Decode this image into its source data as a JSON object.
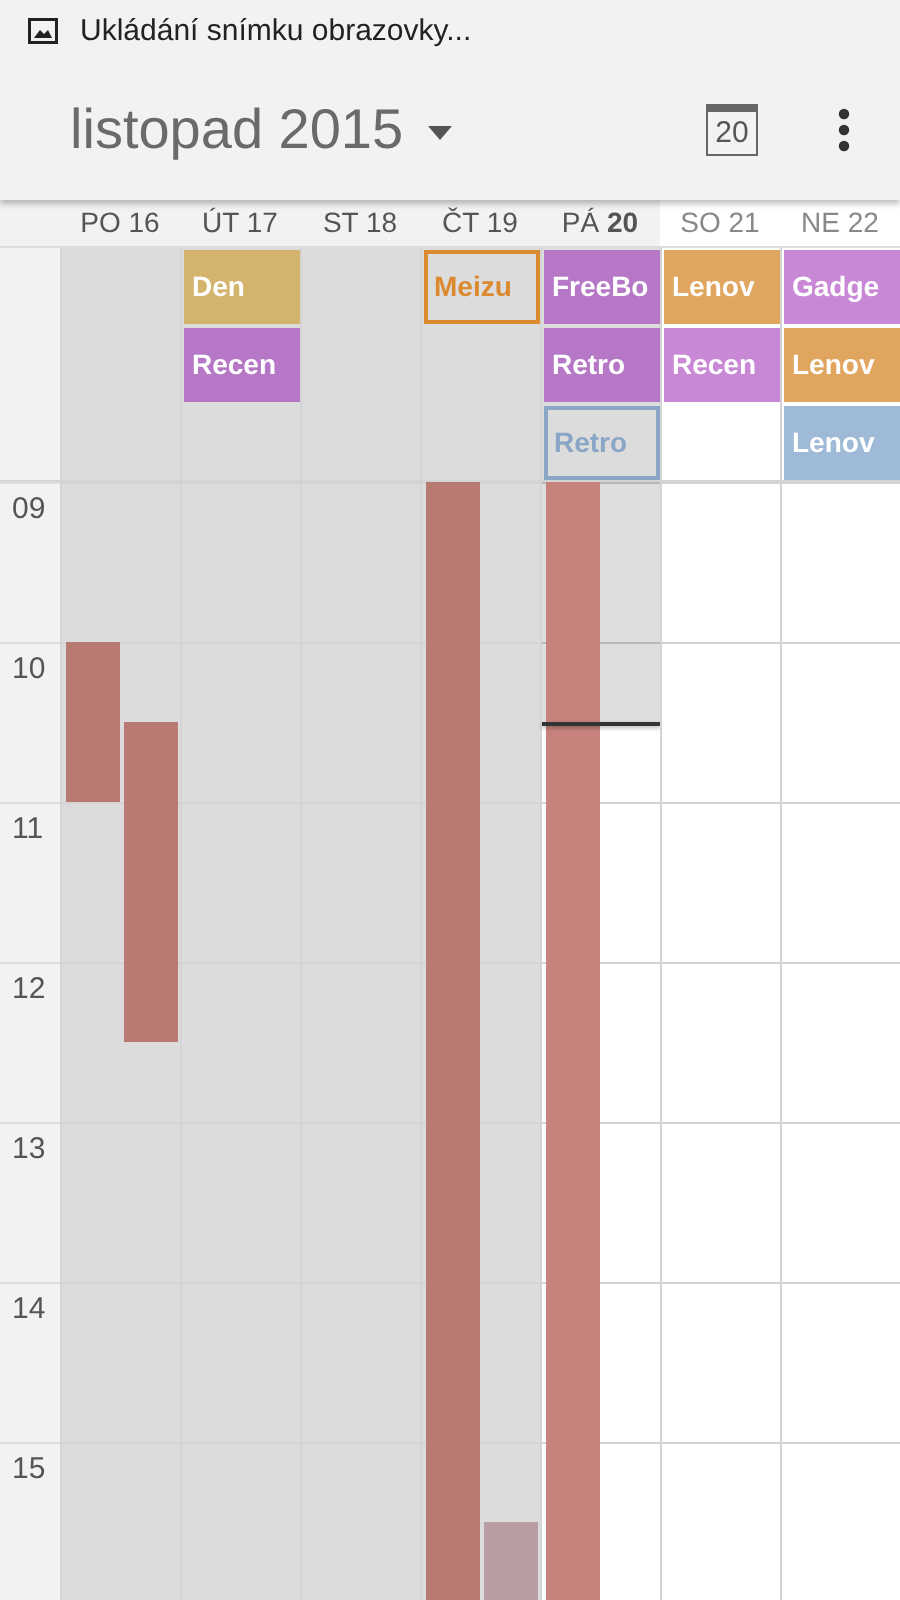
{
  "status_bar": {
    "notification": "Ukládání snímku obrazovky..."
  },
  "toolbar": {
    "title": "listopad 2015",
    "today_button": "20"
  },
  "days": [
    {
      "name": "PO",
      "number": "16",
      "past": true,
      "today": false,
      "events": [
        {
          "color": "#b87a72"
        },
        {
          "color": "#b87a72"
        }
      ]
    },
    {
      "name": "ÚT",
      "number": "17",
      "past": true,
      "today": false,
      "all_day": [
        {
          "title": "Den",
          "color": "#d4b46c",
          "outlined": false
        },
        {
          "title": "Recen",
          "color": "#b577c6",
          "outlined": false
        }
      ]
    },
    {
      "name": "ST",
      "number": "18",
      "past": true,
      "today": false
    },
    {
      "name": "ČT",
      "number": "19",
      "past": true,
      "today": false,
      "all_day": [
        {
          "title": "Meizu",
          "color": "#dc8a30",
          "outlined": true
        }
      ],
      "events": [
        {
          "color": "#b87a72"
        },
        {
          "color": "#b89ea2"
        }
      ]
    },
    {
      "name": "PÁ",
      "number": "20",
      "past": false,
      "today": true,
      "all_day": [
        {
          "title": "FreeBo",
          "color": "#b577c6",
          "outlined": false
        },
        {
          "title": "Retro",
          "color": "#b577c6",
          "outlined": false
        },
        {
          "title": "Retro",
          "color": "#8aa6c6",
          "outlined": true
        }
      ],
      "events": [
        {
          "color": "#c6837d"
        }
      ]
    },
    {
      "name": "SO",
      "number": "21",
      "past": false,
      "today": false,
      "all_day": [
        {
          "title": "Lenov",
          "color": "#e0a55e",
          "outlined": false
        },
        {
          "title": "Recen",
          "color": "#c888d6",
          "outlined": false
        }
      ]
    },
    {
      "name": "NE",
      "number": "22",
      "past": false,
      "today": false,
      "all_day": [
        {
          "title": "Gadge",
          "color": "#c888d6",
          "outlined": false
        },
        {
          "title": "Lenov",
          "color": "#e0a55e",
          "outlined": false
        },
        {
          "title": "Lenov",
          "color": "#9ebad6",
          "outlined": false
        }
      ]
    }
  ],
  "hours": [
    "09",
    "10",
    "11",
    "12",
    "13",
    "14",
    "15"
  ]
}
